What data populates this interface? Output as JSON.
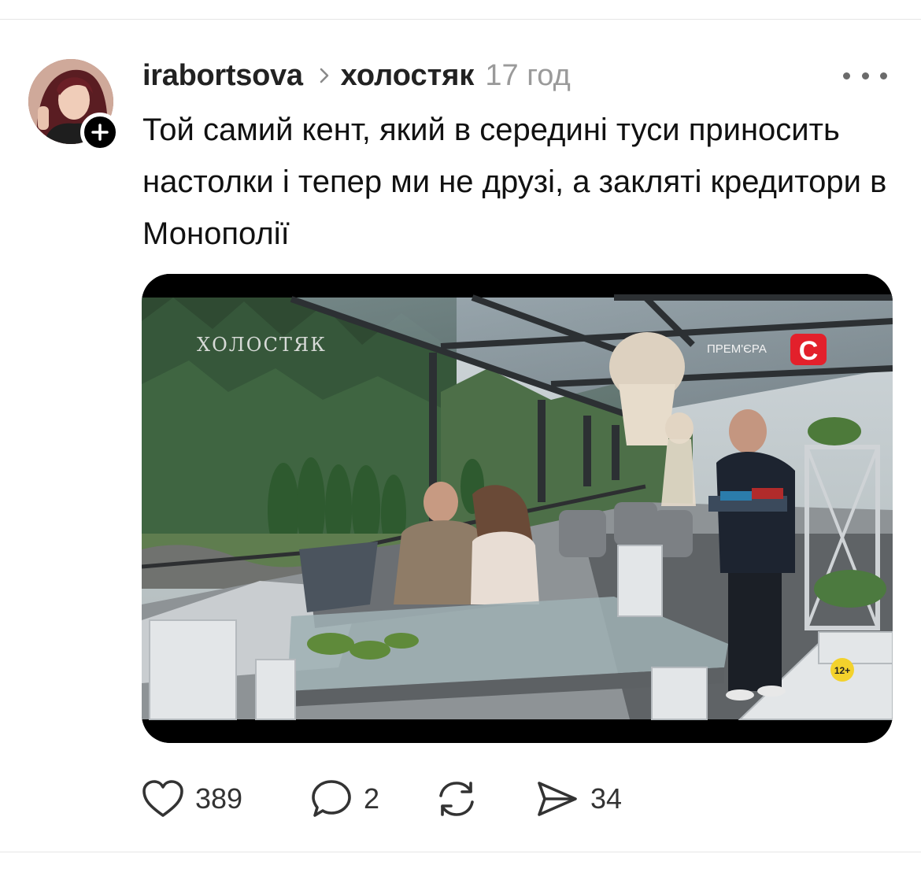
{
  "post": {
    "author": "irabortsova",
    "community": "холостяк",
    "time": "17 год",
    "text": "Той самий кент, який в середині туси приносить настолки і тепер ми не друзі, а закляті кредитори в Монополії",
    "avatar_icon": "user-avatar",
    "follow_icon": "plus-icon",
    "more_icon": "ellipsis-icon"
  },
  "media": {
    "show_logo": "ХОЛОСТЯК",
    "premiere_label": "ПРЕМ'ЄРА",
    "channel_logo": "C",
    "age_rating": "12+",
    "accent_color": "#e3202b"
  },
  "actions": {
    "likes": "389",
    "comments": "2",
    "reposts": "",
    "shares": "34",
    "like_icon": "heart-icon",
    "comment_icon": "comment-bubble-icon",
    "repost_icon": "repost-icon",
    "share_icon": "send-icon"
  }
}
